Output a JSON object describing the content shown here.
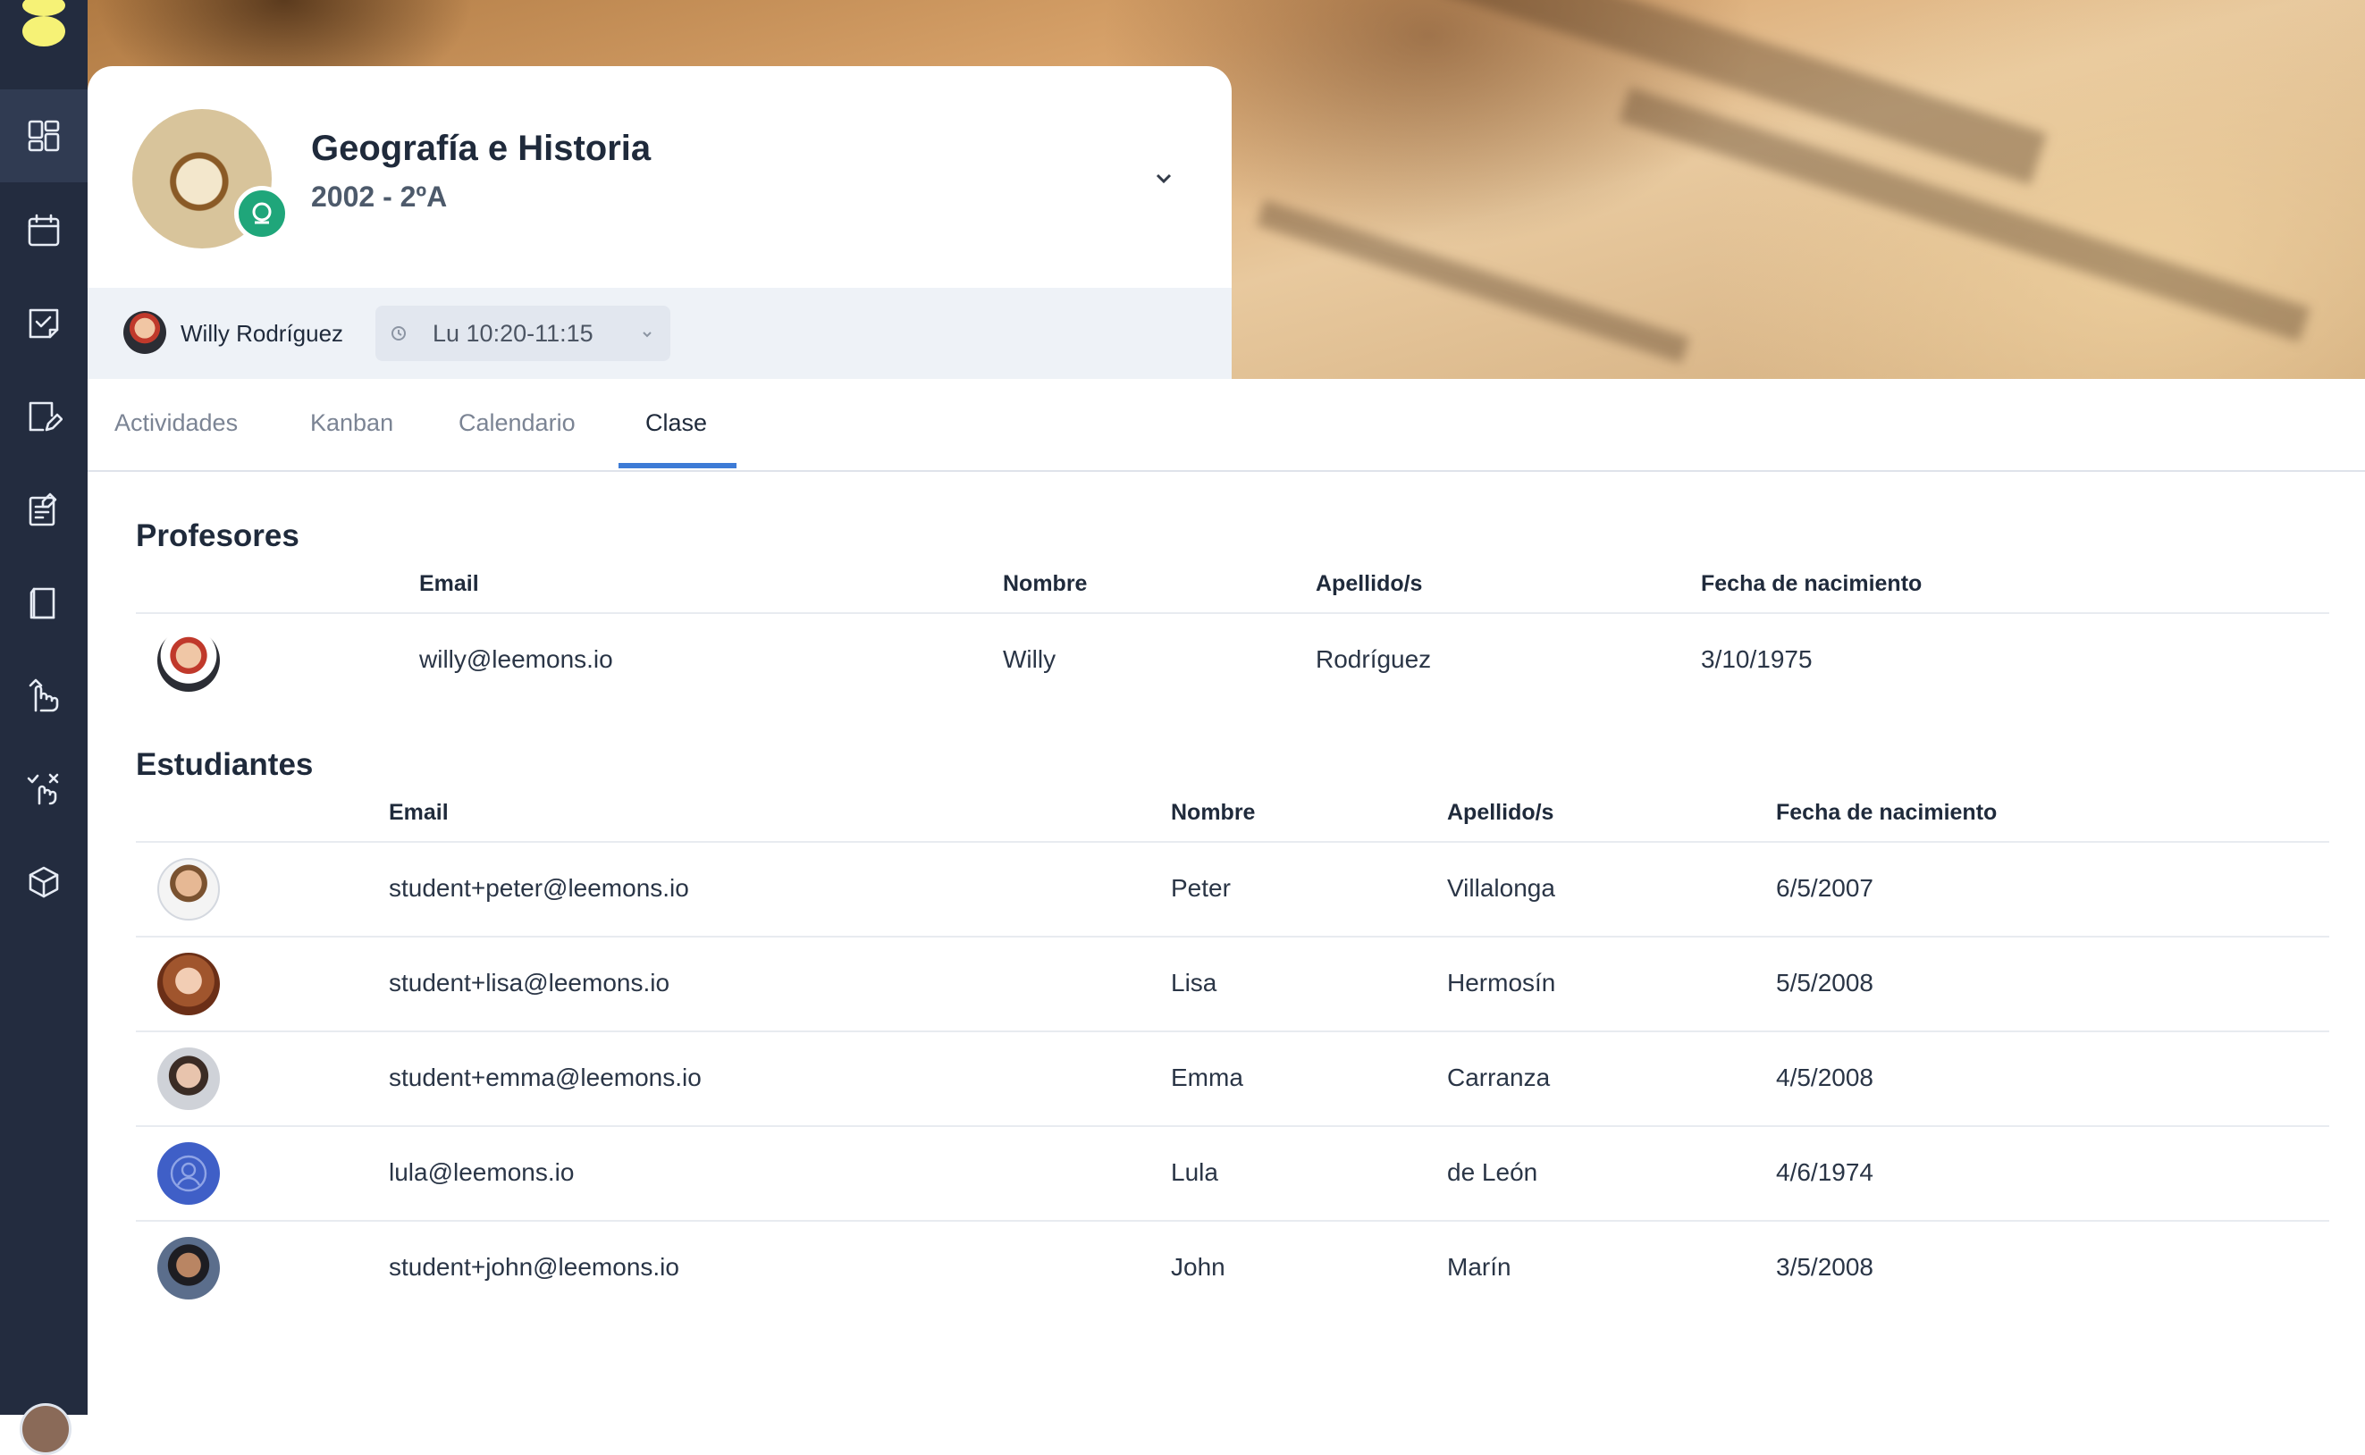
{
  "sidebar": {
    "items": [
      {
        "name": "dashboard",
        "active": true
      },
      {
        "name": "calendar"
      },
      {
        "name": "tasks"
      },
      {
        "name": "notes"
      },
      {
        "name": "assignments"
      },
      {
        "name": "library"
      },
      {
        "name": "curriculum"
      },
      {
        "name": "evaluation"
      },
      {
        "name": "modules"
      }
    ]
  },
  "header": {
    "title": "Geografía e Historia",
    "subtitle": "2002 - 2ºA",
    "teacher_name": "Willy Rodríguez",
    "schedule": "Lu 10:20-11:15"
  },
  "tabs": [
    "Actividades",
    "Kanban",
    "Calendario",
    "Clase"
  ],
  "active_tab": "Clase",
  "teachers": {
    "title": "Profesores",
    "columns": [
      "Email",
      "Nombre",
      "Apellido/s",
      "Fecha de nacimiento"
    ],
    "rows": [
      {
        "email": "willy@leemons.io",
        "name": "Willy",
        "surname": "Rodríguez",
        "birth": "3/10/1975"
      }
    ]
  },
  "students": {
    "title": "Estudiantes",
    "columns": [
      "Email",
      "Nombre",
      "Apellido/s",
      "Fecha de nacimiento"
    ],
    "rows": [
      {
        "email": "student+peter@leemons.io",
        "name": "Peter",
        "surname": "Villalonga",
        "birth": "6/5/2007"
      },
      {
        "email": "student+lisa@leemons.io",
        "name": "Lisa",
        "surname": "Hermosín",
        "birth": "5/5/2008"
      },
      {
        "email": "student+emma@leemons.io",
        "name": "Emma",
        "surname": "Carranza",
        "birth": "4/5/2008"
      },
      {
        "email": "lula@leemons.io",
        "name": "Lula",
        "surname": "de León",
        "birth": "4/6/1974"
      },
      {
        "email": "student+john@leemons.io",
        "name": "John",
        "surname": "Marín",
        "birth": "3/5/2008"
      }
    ]
  },
  "colors": {
    "sidebar": "#232c3f",
    "accent": "#3d7bd6",
    "badge": "#1fa67a",
    "logo": "#f6f276"
  }
}
